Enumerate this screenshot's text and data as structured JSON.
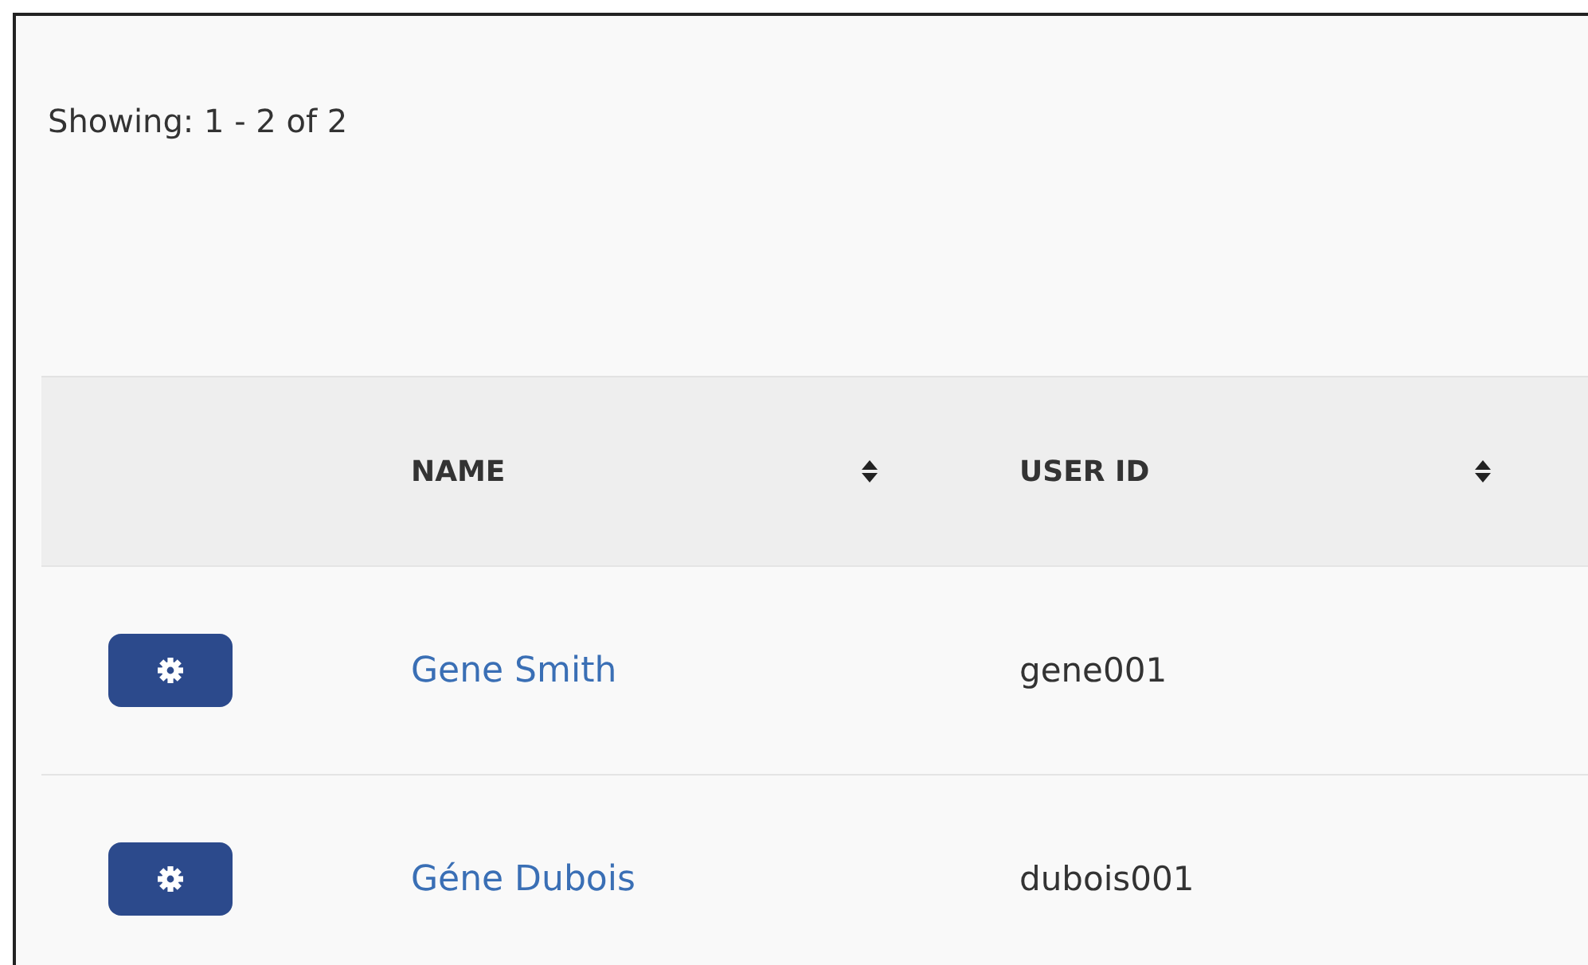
{
  "summary": "Showing: 1 - 2 of 2",
  "table": {
    "columns": [
      {
        "label": "NAME",
        "sortable": true
      },
      {
        "label": "USER ID",
        "sortable": true
      }
    ],
    "rows": [
      {
        "name": "Gene Smith",
        "user_id": "gene001"
      },
      {
        "name": "Géne Dubois",
        "user_id": "dubois001"
      }
    ]
  }
}
